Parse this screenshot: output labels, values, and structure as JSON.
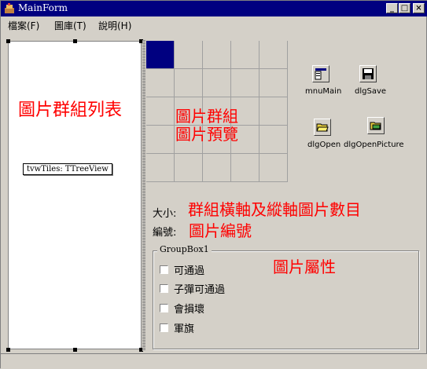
{
  "window": {
    "title": "MainForm"
  },
  "menu": {
    "file": "檔案(F)",
    "library": "圖庫(T)",
    "help": "說明(H)"
  },
  "annotations": {
    "list": "圖片群組列表",
    "preview_line1": "圖片群組",
    "preview_line2": "圖片預覽",
    "size_desc": "群組橫軸及縱軸圖片數目",
    "id_desc": "圖片編號",
    "props": "圖片屬性"
  },
  "tree": {
    "hint": "tvwTiles: TTreeView"
  },
  "components": {
    "mnuMain": "mnuMain",
    "dlgSave": "dlgSave",
    "dlgOpen": "dlgOpen",
    "dlgOpenPicture": "dlgOpenPicture"
  },
  "fields": {
    "size_label": "大小:",
    "id_label": "編號:"
  },
  "groupbox": {
    "title": "GroupBox1",
    "options": [
      "可通過",
      "子彈可通過",
      "會損壞",
      "軍旗"
    ]
  },
  "colors": {
    "titlebar": "#000080",
    "annotation": "#ff0000",
    "face": "#d4d0c8"
  }
}
